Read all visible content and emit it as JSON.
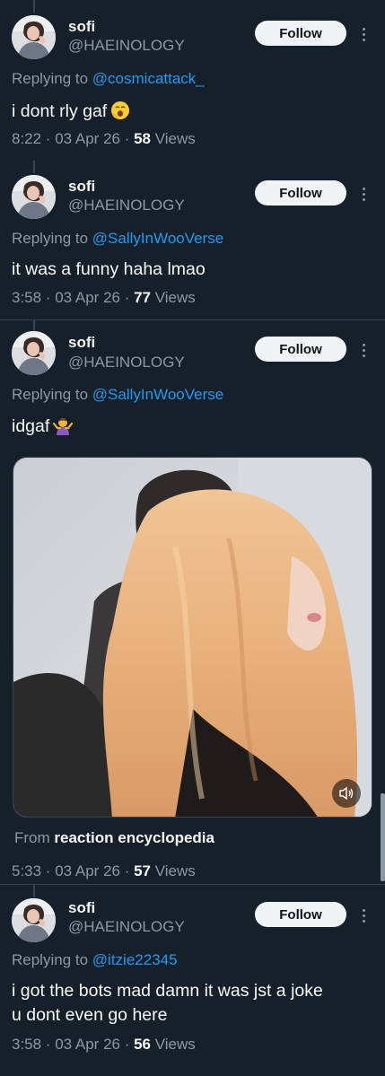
{
  "tweets": [
    {
      "name": "sofi",
      "handle": "@HAEINOLOGY",
      "follow_label": "Follow",
      "replying_prefix": "Replying to",
      "replying_to": "@cosmicattack_",
      "text": "i dont rly gaf",
      "emoji": "yawning-face",
      "time": "8:22 · 03 Apr 26 · ",
      "views_count": "58",
      "views_label": " Views"
    },
    {
      "name": "sofi",
      "handle": "@HAEINOLOGY",
      "follow_label": "Follow",
      "replying_prefix": "Replying to",
      "replying_to": "@SallyInWooVerse",
      "text": "it was a funny haha lmao",
      "time": "3:58 · 03 Apr 26 · ",
      "views_count": "77",
      "views_label": " Views"
    },
    {
      "name": "sofi",
      "handle": "@HAEINOLOGY",
      "follow_label": "Follow",
      "replying_prefix": "Replying to",
      "replying_to": "@SallyInWooVerse",
      "text": "idgaf",
      "emoji": "person-shrugging",
      "media_from_prefix": "From",
      "media_from_source": "reaction encyclopedia",
      "time": "5:33 · 03 Apr 26 · ",
      "views_count": "57",
      "views_label": " Views"
    },
    {
      "name": "sofi",
      "handle": "@HAEINOLOGY",
      "follow_label": "Follow",
      "replying_prefix": "Replying to",
      "replying_to": "@itzie22345",
      "text_line1": "i got the bots mad damn it was jst a joke",
      "text_line2": "u dont even go here",
      "time": "3:58 · 03 Apr 26 · ",
      "views_count": "56",
      "views_label": " Views"
    }
  ],
  "colors": {
    "background": "#15202b",
    "link": "#1d9bf0",
    "secondary_text": "#8b98a5",
    "divider": "#38444d",
    "follow_button": "#eff3f4"
  }
}
